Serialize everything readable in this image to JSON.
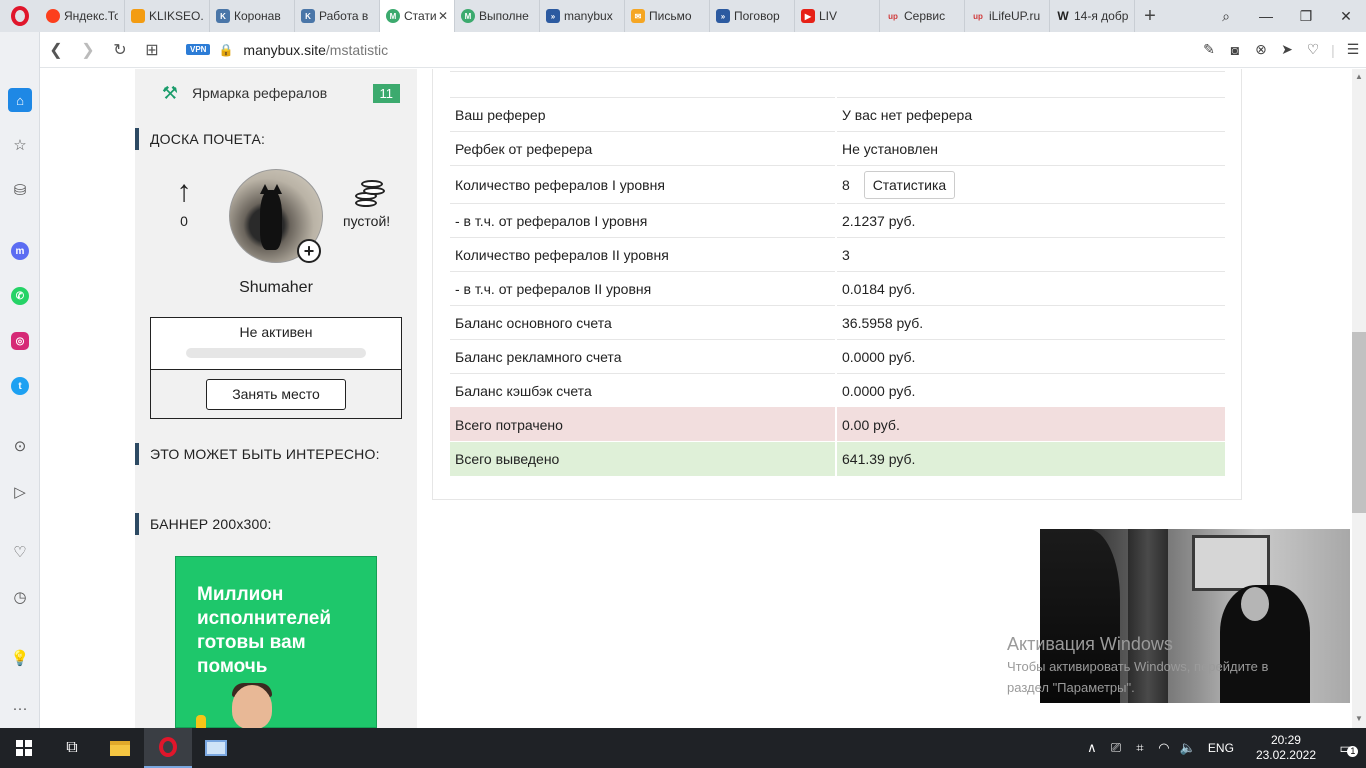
{
  "browser": {
    "tabs": [
      {
        "label": "Яндекс.То",
        "icon": "yandex-icon",
        "color": "#fc3f1d"
      },
      {
        "label": "KLIKSEO.r",
        "icon": "klikseo-icon",
        "color": "#f39c12"
      },
      {
        "label": "Коронав",
        "icon": "vk-icon",
        "color": "#4a76a8"
      },
      {
        "label": "Работа в",
        "icon": "vk-icon",
        "color": "#4a76a8"
      },
      {
        "label": "Стати",
        "icon": "manybux-icon",
        "color": "#3caa6e",
        "active": true,
        "close": "✕"
      },
      {
        "label": "Выполне",
        "icon": "manybux-icon",
        "color": "#3caa6e"
      },
      {
        "label": "manybux",
        "icon": "manybux-ext-icon",
        "color": "#2c5aa0"
      },
      {
        "label": "Письмо",
        "icon": "mail-icon",
        "color": "#f5a623"
      },
      {
        "label": "Поговор",
        "icon": "manybux-ext-icon",
        "color": "#2c5aa0"
      },
      {
        "label": "LIV",
        "icon": "youtube-live-icon",
        "color": "#e62117"
      },
      {
        "label": "Сервис",
        "icon": "up-icon",
        "color": "#d03b3b"
      },
      {
        "label": "iLifeUP.ru",
        "icon": "up-icon",
        "color": "#d03b3b"
      },
      {
        "label": "14-я добр",
        "icon": "wikipedia-icon",
        "color": "#444444"
      }
    ],
    "url_host": "manybux.site",
    "url_path": "/mstatistic",
    "vpn_label": "VPN"
  },
  "sidebar": {
    "ref_fair_label": "Ярмарка рефералов",
    "ref_fair_count": "11",
    "honor_title": "ДОСКА ПОЧЕТА:",
    "honor_up_count": "0",
    "honor_empty_label": "пустой!",
    "username": "Shumaher",
    "status_text": "Не активен",
    "take_place_button": "Занять место",
    "interesting_title": "ЭТО МОЖЕТ БЫТЬ ИНТЕРЕСНО:",
    "banner_title": "БАННЕР 200x300:",
    "banner_text_1": "Миллион",
    "banner_text_2": "исполнителей",
    "banner_text_3": "готовы вам",
    "banner_text_4": "помочь"
  },
  "stats": {
    "rows": [
      {
        "label": "Ваш реферер",
        "value": "У вас нет реферера"
      },
      {
        "label": "Рефбек от реферера",
        "value": "Не установлен"
      },
      {
        "label": "Количество рефералов I уровня",
        "value": "8",
        "button": "Статистика"
      },
      {
        "label": "- в т.ч. от рефералов I уровня",
        "value": "2.1237 руб."
      },
      {
        "label": "Количество рефералов II уровня",
        "value": "3"
      },
      {
        "label": "- в т.ч. от рефералов II уровня",
        "value": "0.0184 руб."
      },
      {
        "label": "Баланс основного счета",
        "value": "36.5958 руб."
      },
      {
        "label": "Баланс рекламного счета",
        "value": "0.0000 руб."
      },
      {
        "label": "Баланс кэшбэк счета",
        "value": "0.0000 руб."
      },
      {
        "label": "Всего потрачено",
        "value": "0.00 руб."
      },
      {
        "label": "Всего выведено",
        "value": "641.39 руб."
      }
    ]
  },
  "windows_watermark": {
    "title": "Активация Windows",
    "line1": "Чтобы активировать Windows, перейдите в",
    "line2": "раздел \"Параметры\"."
  },
  "taskbar": {
    "lang": "ENG",
    "time": "20:29",
    "date": "23.02.2022",
    "notification_count": "1"
  }
}
